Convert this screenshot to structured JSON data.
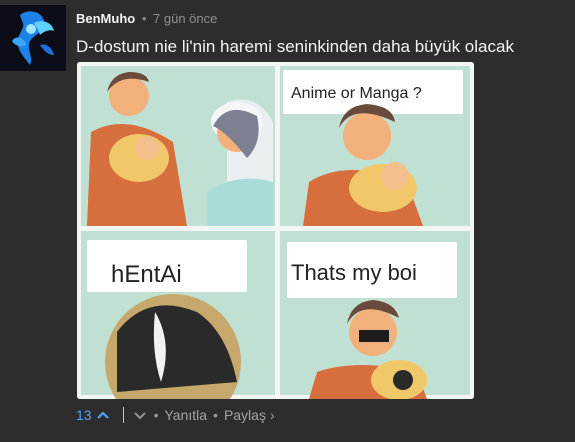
{
  "comment": {
    "username": "BenMuho",
    "separator": "•",
    "timestamp": "7 gün önce",
    "text": "D-dostum nie li'nin haremi seninkinden daha büyük olacak",
    "avatar_icon": "blue-spirit-avatar",
    "meme": {
      "panel1_caption": "",
      "panel2_caption": "Anime or Manga ?",
      "panel3_caption": "hEntAi",
      "panel4_caption": "Thats my boi"
    },
    "actions": {
      "vote_count": "13",
      "upvote_icon": "chevron-up-icon",
      "downvote_icon": "chevron-down-icon",
      "dot1": "•",
      "reply_label": "Yanıtla",
      "dot2": "•",
      "share_label": "Paylaş",
      "share_chevron": "›"
    },
    "colors": {
      "background": "#2d2d2d",
      "vote_accent": "#4ea3ff",
      "panel_bg": "#bfe0d2"
    }
  }
}
